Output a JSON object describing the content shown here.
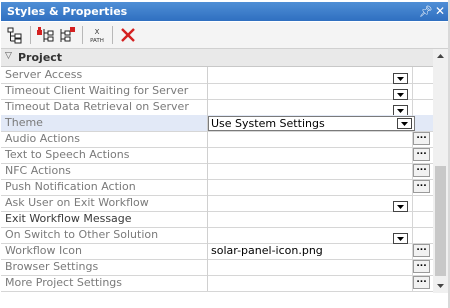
{
  "window": {
    "title": "Styles & Properties"
  },
  "toolbar": {
    "buttons": [
      "tree-view",
      "add-item",
      "add-item-alt",
      "xpath",
      "delete"
    ],
    "xpath_label_top": "X",
    "xpath_label_bottom": "PATH"
  },
  "section": {
    "label": "Project"
  },
  "rows": [
    {
      "name": "Server Access",
      "value": "",
      "control": "dropdown",
      "bold": false
    },
    {
      "name": "Timeout Client Waiting for Server",
      "value": "",
      "control": "dropdown",
      "bold": false
    },
    {
      "name": "Timeout Data Retrieval on Server",
      "value": "",
      "control": "dropdown",
      "bold": false
    },
    {
      "name": "Theme",
      "value": "Use System Settings",
      "control": "combo",
      "bold": false,
      "selected": true
    },
    {
      "name": "Audio Actions",
      "value": "",
      "control": "ellipsis",
      "bold": false
    },
    {
      "name": "Text to Speech Actions",
      "value": "",
      "control": "ellipsis",
      "bold": false
    },
    {
      "name": "NFC Actions",
      "value": "",
      "control": "ellipsis",
      "bold": false
    },
    {
      "name": "Push Notification Action",
      "value": "",
      "control": "ellipsis",
      "bold": false
    },
    {
      "name": "Ask User on Exit Workflow",
      "value": "",
      "control": "dropdown",
      "bold": false
    },
    {
      "name": "Exit Workflow Message",
      "value": "",
      "control": "none",
      "bold": true
    },
    {
      "name": "On Switch to Other Solution",
      "value": "",
      "control": "dropdown",
      "bold": false
    },
    {
      "name": "Workflow Icon",
      "value": "solar-panel-icon.png",
      "control": "ellipsis",
      "bold": false
    },
    {
      "name": "Browser Settings",
      "value": "",
      "control": "ellipsis",
      "bold": false
    },
    {
      "name": "More Project Settings",
      "value": "",
      "control": "ellipsis",
      "bold": false
    }
  ],
  "ellipsis_label": "...",
  "colors": {
    "title_bar": "#2f6fc0",
    "selected_row": "#e2e9f7",
    "delete_icon": "#d42020"
  }
}
